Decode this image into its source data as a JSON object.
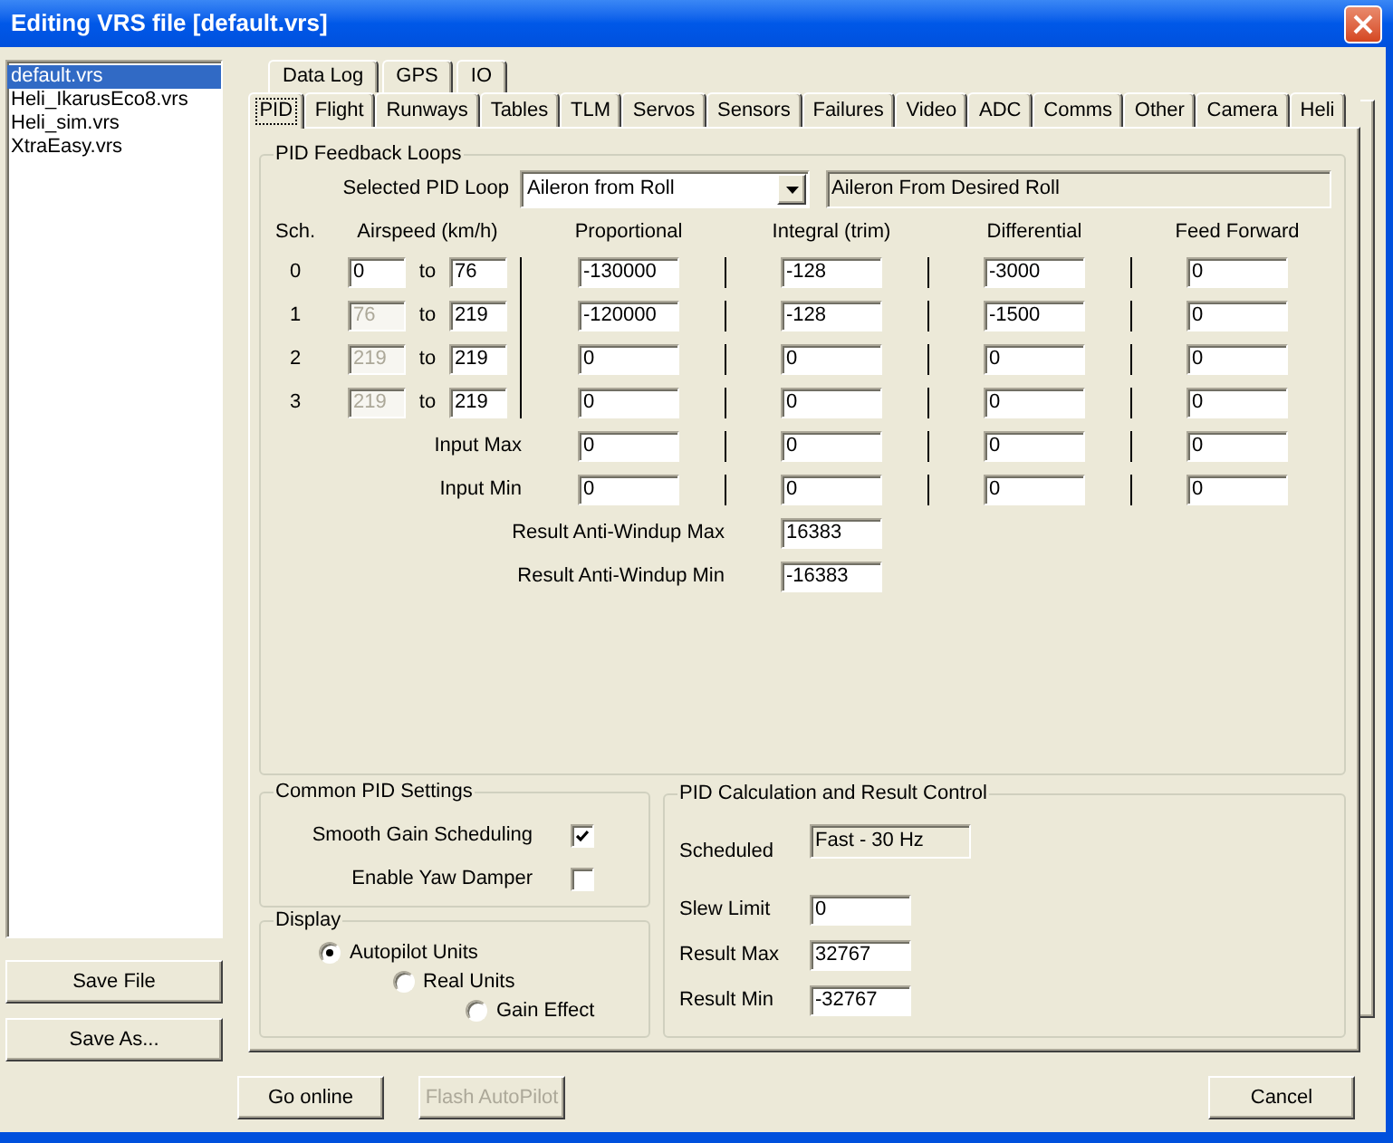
{
  "window": {
    "title": "Editing VRS file [default.vrs]"
  },
  "files": [
    {
      "name": "default.vrs",
      "selected": true
    },
    {
      "name": "Heli_IkarusEco8.vrs",
      "selected": false
    },
    {
      "name": "Heli_sim.vrs",
      "selected": false
    },
    {
      "name": "XtraEasy.vrs",
      "selected": false
    }
  ],
  "file_buttons": [
    "Save File",
    "Save As..."
  ],
  "tab_rows": [
    {
      "tabs": [
        {
          "label": "Data Log",
          "selected": false
        },
        {
          "label": "GPS",
          "selected": false
        },
        {
          "label": "IO",
          "selected": false
        }
      ]
    },
    {
      "tabs": [
        {
          "label": "PID",
          "selected": true
        },
        {
          "label": "Flight",
          "selected": false
        },
        {
          "label": "Runways",
          "selected": false
        },
        {
          "label": "Tables",
          "selected": false
        },
        {
          "label": "TLM",
          "selected": false
        },
        {
          "label": "Servos",
          "selected": false
        },
        {
          "label": "Sensors",
          "selected": false
        },
        {
          "label": "Failures",
          "selected": false
        },
        {
          "label": "Video",
          "selected": false
        },
        {
          "label": "ADC",
          "selected": false
        },
        {
          "label": "Comms",
          "selected": false
        },
        {
          "label": "Other",
          "selected": false
        },
        {
          "label": "Camera",
          "selected": false
        },
        {
          "label": "Heli",
          "selected": false
        }
      ]
    }
  ],
  "pid_feedback": {
    "title": "PID Feedback Loops",
    "loop_label": "Selected PID Loop",
    "loop_value": "Aileron from Roll",
    "description": "Aileron From Desired Roll",
    "columns": [
      "Sch.",
      "Airspeed (km/h)",
      "Proportional",
      "Integral (trim)",
      "Differential",
      "Feed Forward"
    ],
    "schedules": [
      {
        "sch": "0",
        "from": "0",
        "from_disabled": false,
        "to_label": "to",
        "to": "76",
        "gains": [
          "-130000",
          "-128",
          "-3000",
          "0"
        ]
      },
      {
        "sch": "1",
        "from": "76",
        "from_disabled": true,
        "to_label": "to",
        "to": "219",
        "gains": [
          "-120000",
          "-128",
          "-1500",
          "0"
        ]
      },
      {
        "sch": "2",
        "from": "219",
        "from_disabled": true,
        "to_label": "to",
        "to": "219",
        "gains": [
          "0",
          "0",
          "0",
          "0"
        ]
      },
      {
        "sch": "3",
        "from": "219",
        "from_disabled": true,
        "to_label": "to",
        "to": "219",
        "gains": [
          "0",
          "0",
          "0",
          "0"
        ]
      }
    ],
    "input_rows": [
      {
        "label": "Input Max",
        "values": [
          "0",
          "0",
          "0",
          "0"
        ]
      },
      {
        "label": "Input Min",
        "values": [
          "0",
          "0",
          "0",
          "0"
        ]
      }
    ],
    "anti_windup": [
      {
        "label": "Result Anti-Windup Max",
        "value": "16383"
      },
      {
        "label": "Result Anti-Windup Min",
        "value": "-16383"
      }
    ]
  },
  "common_pid": {
    "title": "Common PID Settings",
    "options": [
      {
        "label": "Smooth Gain Scheduling",
        "checked": true
      },
      {
        "label": "Enable Yaw Damper",
        "checked": false
      }
    ]
  },
  "display": {
    "title": "Display",
    "options": [
      {
        "label": "Autopilot Units",
        "selected": true
      },
      {
        "label": "Real Units",
        "selected": false
      },
      {
        "label": "Gain Effect",
        "selected": false
      }
    ]
  },
  "result_control": {
    "title": "PID Calculation and Result Control",
    "scheduled": {
      "label": "Scheduled",
      "value": "Fast - 30 Hz"
    },
    "fields": [
      {
        "label": "Slew Limit",
        "value": "0"
      },
      {
        "label": "Result Max",
        "value": "32767"
      },
      {
        "label": "Result Min",
        "value": "-32767"
      }
    ]
  },
  "footer": {
    "left_buttons": [
      {
        "label": "Go online",
        "disabled": false
      },
      {
        "label": "Flash AutoPilot",
        "disabled": true
      }
    ],
    "right_buttons": [
      {
        "label": "Cancel",
        "disabled": false
      }
    ]
  }
}
